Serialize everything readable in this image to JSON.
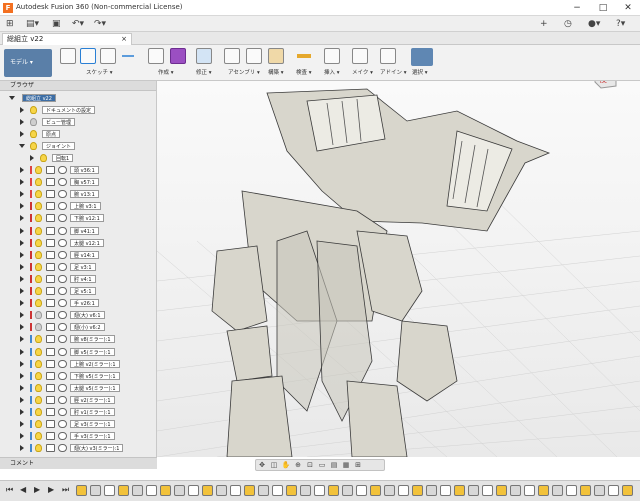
{
  "window": {
    "title": "Autodesk Fusion 360 (Non-commercial License)",
    "minimize": "−",
    "maximize": "□",
    "close": "✕"
  },
  "tab": {
    "label": "総組立 v22",
    "close": "×"
  },
  "workspace": {
    "label": "モデル"
  },
  "toolbar": {
    "groups": [
      {
        "label": "スケッチ ▾"
      },
      {
        "label": "作成 ▾"
      },
      {
        "label": "修正 ▾"
      },
      {
        "label": "アセンブリ ▾"
      },
      {
        "label": "構築 ▾"
      },
      {
        "label": "検査 ▾"
      },
      {
        "label": "挿入 ▾"
      },
      {
        "label": "メイク ▾"
      },
      {
        "label": "アドイン ▾"
      },
      {
        "label": "選択 ▾"
      }
    ]
  },
  "viewcube": {
    "face": "後"
  },
  "browser": {
    "header": "ブラウザ",
    "root": "総組立 v22",
    "system_rows": [
      "ドキュメントの設定",
      "ビュー管理",
      "原点",
      "ジョイント",
      "回転1"
    ],
    "components": [
      "頭 v36:1",
      "胸 v57:1",
      "腕 v13:1",
      "上腕 v3:1",
      "下腕 v12:1",
      "脚 v41:1",
      "太腿 v12:1",
      "脛 v14:1",
      "足 v3:1",
      "肘 v4:1",
      "足 v5:1",
      "手 v26:1",
      "翅(大) v6:1",
      "翅(小) v6:2",
      "腕 v8(ミラー):1",
      "脚 v5(ミラー):1",
      "上腕 v2(ミラー):1",
      "下腕 v5(ミラー):1",
      "太腿 v5(ミラー):1",
      "脛 v2(ミラー):1",
      "肘 v1(ミラー):1",
      "足 v3(ミラー):1",
      "手 v3(ミラー):1",
      "翅(大) v3(ミラー):1"
    ],
    "bar_colors": [
      "#d44",
      "#d44",
      "#d44",
      "#c33",
      "#c33",
      "#c33",
      "#c33",
      "#c33",
      "#c33",
      "#c33",
      "#c33",
      "#c33",
      "#c33",
      "#c33",
      "#48c",
      "#48c",
      "#48c",
      "#48c",
      "#48c",
      "#48c",
      "#48c",
      "#48c",
      "#48c",
      "#48c"
    ],
    "visible": [
      true,
      true,
      true,
      true,
      true,
      true,
      true,
      true,
      true,
      true,
      true,
      true,
      false,
      false,
      true,
      true,
      true,
      true,
      true,
      true,
      true,
      true,
      true,
      true
    ]
  },
  "comment": {
    "label": "コメント"
  }
}
